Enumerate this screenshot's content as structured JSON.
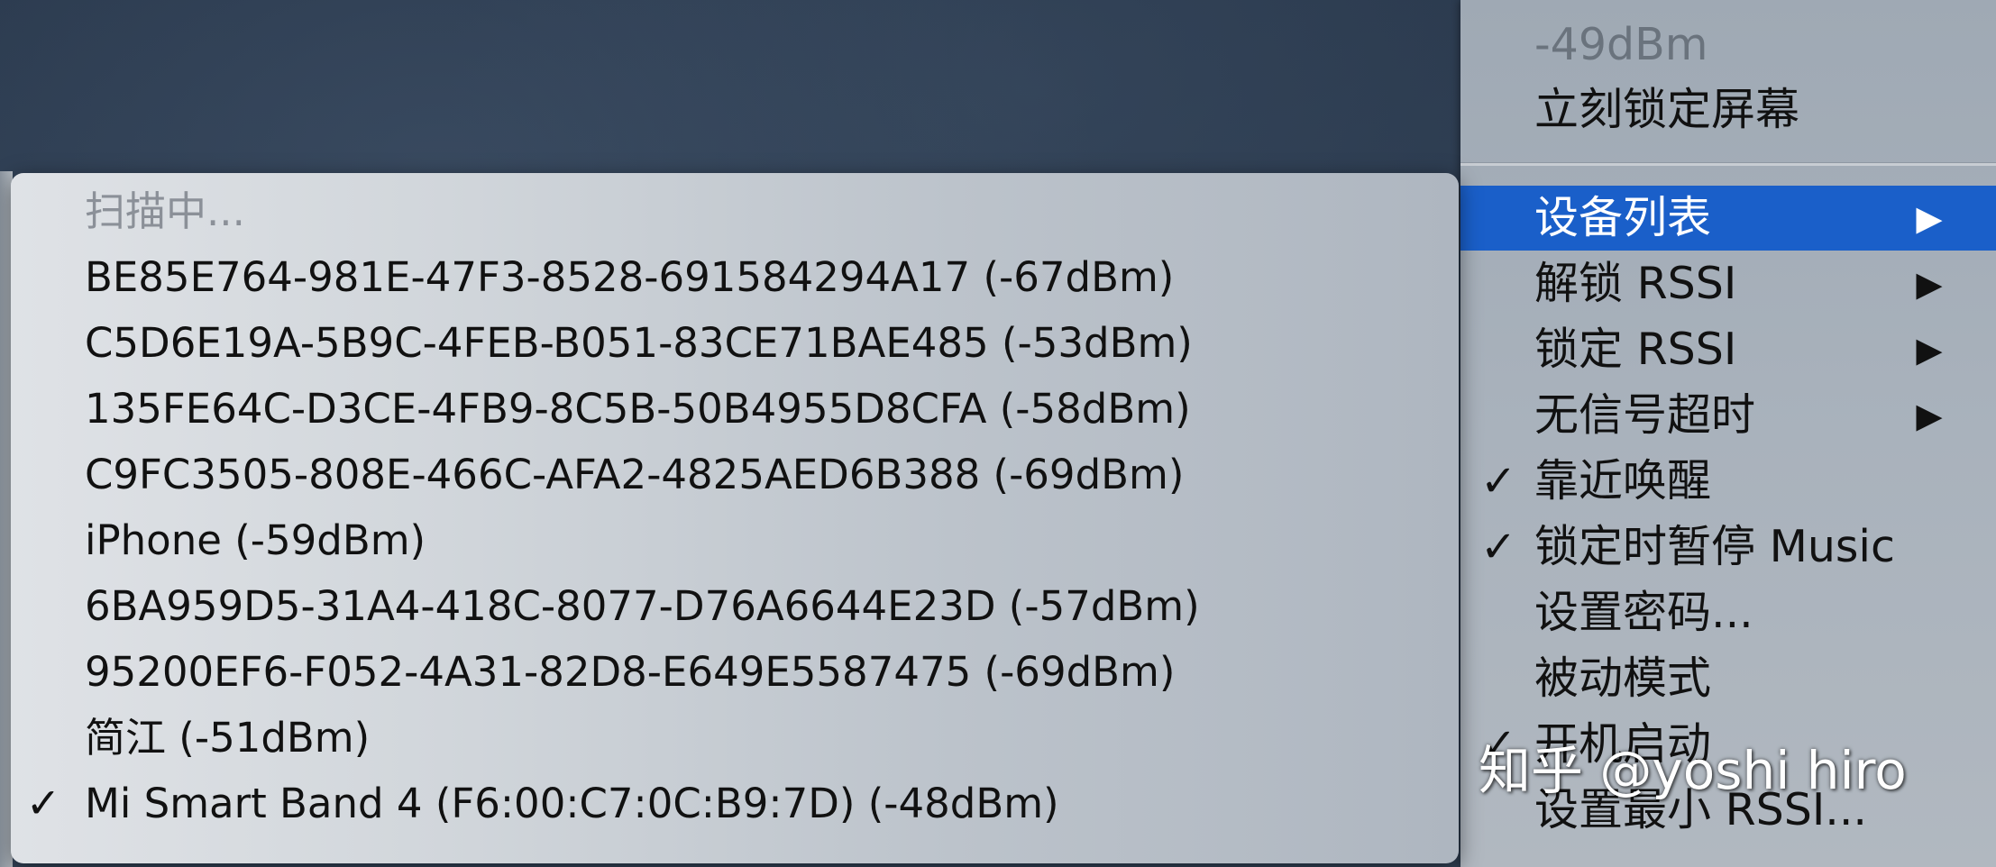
{
  "main_menu": {
    "items": [
      {
        "label": "-49dBm",
        "check": "",
        "arrow": "",
        "disabled": true
      },
      {
        "label": "立刻锁定屏幕",
        "check": "",
        "arrow": ""
      },
      {
        "label": "设备列表",
        "check": "",
        "arrow": "▶",
        "highlighted": true
      },
      {
        "label": "解锁 RSSI",
        "check": "",
        "arrow": "▶"
      },
      {
        "label": "锁定 RSSI",
        "check": "",
        "arrow": "▶"
      },
      {
        "label": "无信号超时",
        "check": "",
        "arrow": "▶"
      },
      {
        "label": "靠近唤醒",
        "check": "✓",
        "arrow": ""
      },
      {
        "label": "锁定时暂停 Music",
        "check": "✓",
        "arrow": ""
      },
      {
        "label": "设置密码...",
        "check": "",
        "arrow": ""
      },
      {
        "label": "被动模式",
        "check": "",
        "arrow": ""
      },
      {
        "label": "开机启动",
        "check": "✓",
        "arrow": ""
      },
      {
        "label": "设置最小 RSSI...",
        "check": "",
        "arrow": ""
      }
    ]
  },
  "device_list": {
    "items": [
      {
        "label": "扫描中...",
        "check": "",
        "disabled": true
      },
      {
        "label": "BE85E764-981E-47F3-8528-691584294A17 (-67dBm)",
        "check": ""
      },
      {
        "label": "C5D6E19A-5B9C-4FEB-B051-83CE71BAE485 (-53dBm)",
        "check": ""
      },
      {
        "label": "135FE64C-D3CE-4FB9-8C5B-50B4955D8CFA (-58dBm)",
        "check": ""
      },
      {
        "label": "C9FC3505-808E-466C-AFA2-4825AED6B388 (-69dBm)",
        "check": ""
      },
      {
        "label": "iPhone (-59dBm)",
        "check": ""
      },
      {
        "label": "6BA959D5-31A4-418C-8077-D76A6644E23D (-57dBm)",
        "check": ""
      },
      {
        "label": "95200EF6-F052-4A31-82D8-E649E5587475 (-69dBm)",
        "check": ""
      },
      {
        "label": "简江 (-51dBm)",
        "check": ""
      },
      {
        "label": "Mi Smart Band 4 (F6:00:C7:0C:B9:7D) (-48dBm)",
        "check": "✓"
      }
    ]
  },
  "watermark": "知乎 @yoshi hiro",
  "colors": {
    "highlight": "#1a5fc9",
    "menu_bg": "#a9b2bc",
    "submenu_bg": "#d1d6db"
  }
}
